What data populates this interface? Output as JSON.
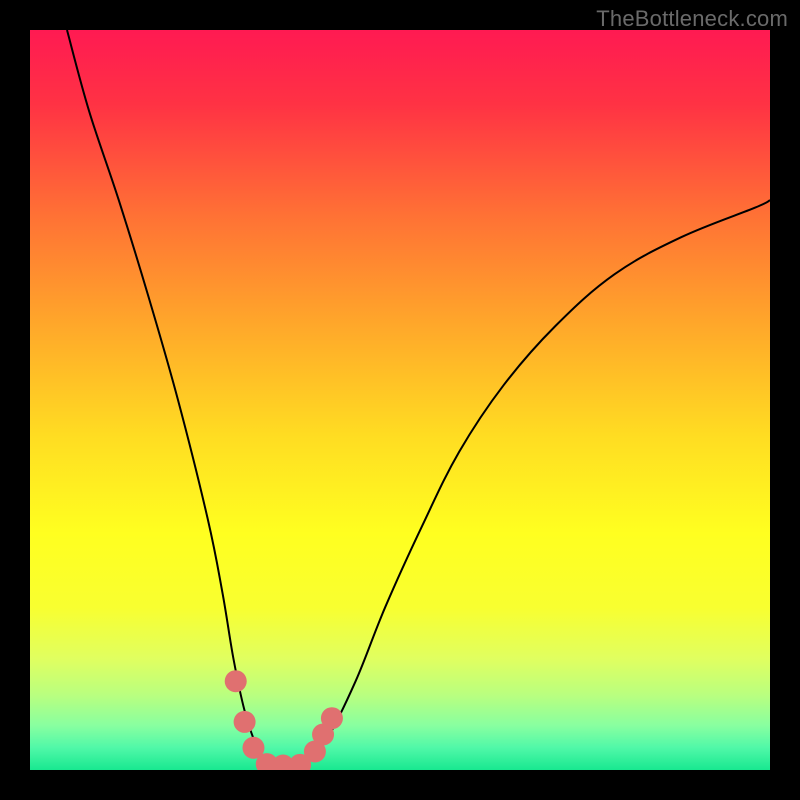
{
  "watermark": "TheBottleneck.com",
  "chart_data": {
    "type": "line",
    "title": "",
    "xlabel": "",
    "ylabel": "",
    "xlim": [
      0,
      100
    ],
    "ylim": [
      0,
      100
    ],
    "grid": false,
    "legend": false,
    "gradient_stops": [
      {
        "offset": 0.0,
        "color": "#ff1a52"
      },
      {
        "offset": 0.1,
        "color": "#ff3244"
      },
      {
        "offset": 0.25,
        "color": "#ff7135"
      },
      {
        "offset": 0.4,
        "color": "#ffa82a"
      },
      {
        "offset": 0.55,
        "color": "#ffdd22"
      },
      {
        "offset": 0.68,
        "color": "#ffff20"
      },
      {
        "offset": 0.78,
        "color": "#f8ff30"
      },
      {
        "offset": 0.85,
        "color": "#e0ff60"
      },
      {
        "offset": 0.9,
        "color": "#b8ff80"
      },
      {
        "offset": 0.94,
        "color": "#88ffa0"
      },
      {
        "offset": 0.97,
        "color": "#50f8a8"
      },
      {
        "offset": 1.0,
        "color": "#18e890"
      }
    ],
    "series": [
      {
        "name": "bottleneck-curve",
        "color": "#000000",
        "width": 2,
        "x": [
          5,
          8,
          12,
          16,
          20,
          24,
          26,
          27.5,
          29,
          30.5,
          32,
          34,
          37,
          40,
          44,
          48,
          53,
          58,
          64,
          71,
          79,
          88,
          98,
          100
        ],
        "y": [
          100,
          89,
          77,
          64,
          50,
          34,
          24,
          15,
          8,
          3.5,
          0.8,
          0.5,
          0.8,
          4,
          12,
          22,
          33,
          43,
          52,
          60,
          67,
          72,
          76,
          77
        ]
      },
      {
        "name": "near-optimal-markers",
        "color": "#e07070",
        "type": "scatter",
        "marker_size": 11,
        "x": [
          27.8,
          29.0,
          30.2,
          32.0,
          34.2,
          36.5,
          38.5,
          39.6,
          40.8
        ],
        "y": [
          12.0,
          6.5,
          3.0,
          0.8,
          0.6,
          0.7,
          2.5,
          4.8,
          7.0
        ]
      }
    ],
    "optimum_x": 33,
    "annotations": []
  }
}
